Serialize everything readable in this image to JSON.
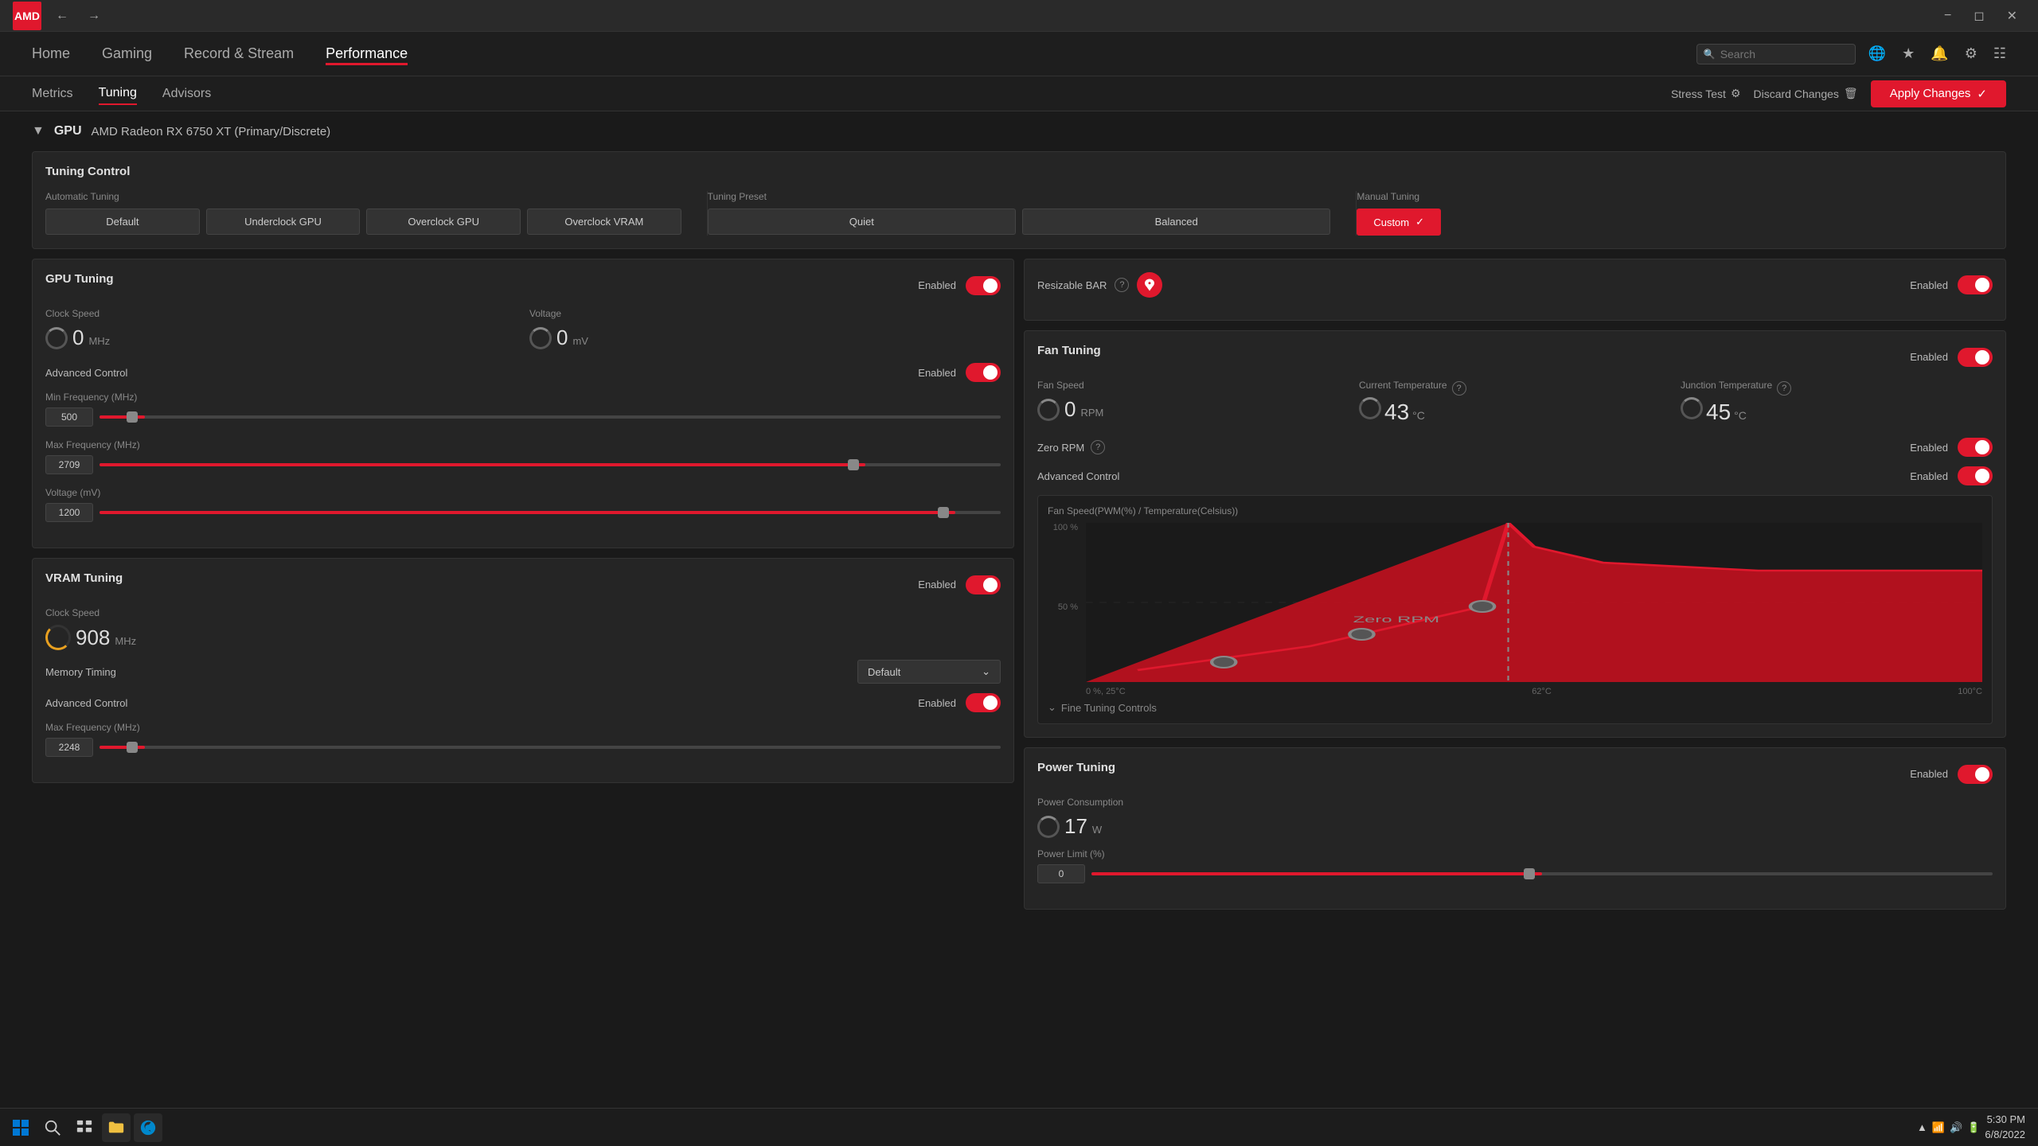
{
  "app": {
    "logo": "AMD",
    "nav": {
      "back_icon": "←",
      "forward_icon": "→",
      "items": [
        "Home",
        "Gaming",
        "Record & Stream",
        "Performance"
      ],
      "active": "Performance"
    },
    "search": {
      "placeholder": "Search"
    },
    "nav_icons": [
      "globe-icon",
      "star-icon",
      "bell-icon",
      "gear-icon",
      "grid-icon"
    ],
    "window_controls": [
      "minimize-icon",
      "restore-icon",
      "close-icon"
    ]
  },
  "sub_nav": {
    "items": [
      "Metrics",
      "Tuning",
      "Advisors"
    ],
    "active": "Tuning",
    "stress_test": "Stress Test",
    "discard": "Discard Changes",
    "apply": "Apply Changes"
  },
  "gpu_section": {
    "label": "GPU",
    "name": "AMD Radeon RX 6750 XT (Primary/Discrete)"
  },
  "tuning_control": {
    "title": "Tuning Control",
    "automatic_tuning": {
      "label": "Automatic Tuning",
      "presets": [
        "Default",
        "Underclock GPU",
        "Overclock GPU",
        "Overclock VRAM"
      ]
    },
    "tuning_preset": {
      "label": "Tuning Preset",
      "presets": [
        "Quiet",
        "Balanced"
      ]
    },
    "manual_tuning": {
      "label": "Manual Tuning",
      "value": "Custom"
    }
  },
  "gpu_tuning": {
    "title": "GPU Tuning",
    "enabled_label": "Enabled",
    "enabled": true,
    "clock_speed": {
      "label": "Clock Speed",
      "value": "0",
      "unit": "MHz"
    },
    "voltage": {
      "label": "Voltage",
      "value": "0",
      "unit": "mV"
    },
    "advanced_control": {
      "label": "Advanced Control",
      "value": "Enabled",
      "enabled": true
    },
    "min_frequency": {
      "label": "Min Frequency (MHz)",
      "value": "500",
      "slider_pct": 5
    },
    "max_frequency": {
      "label": "Max Frequency (MHz)",
      "value": "2709",
      "slider_pct": 85
    },
    "voltage_mv": {
      "label": "Voltage (mV)",
      "value": "1200",
      "slider_pct": 95
    }
  },
  "vram_tuning": {
    "title": "VRAM Tuning",
    "enabled_label": "Enabled",
    "enabled": true,
    "clock_speed": {
      "label": "Clock Speed",
      "value": "908",
      "unit": "MHz"
    },
    "memory_timing": {
      "label": "Memory Timing",
      "value": "Default"
    },
    "advanced_control": {
      "label": "Advanced Control",
      "value": "Enabled",
      "enabled": true
    },
    "max_frequency": {
      "label": "Max Frequency (MHz)",
      "value": "2248",
      "slider_pct": 5
    }
  },
  "resizable_bar": {
    "label": "Resizable BAR",
    "enabled_label": "Enabled",
    "enabled": true
  },
  "fan_tuning": {
    "title": "Fan Tuning",
    "enabled_label": "Enabled",
    "enabled": true,
    "fan_speed": {
      "label": "Fan Speed",
      "value": "0",
      "unit": "RPM"
    },
    "current_temperature": {
      "label": "Current Temperature",
      "value": "43",
      "unit": "°C"
    },
    "junction_temperature": {
      "label": "Junction Temperature",
      "value": "45",
      "unit": "°C"
    },
    "zero_rpm": {
      "label": "Zero RPM",
      "enabled_label": "Enabled",
      "enabled": true
    },
    "advanced_control": {
      "label": "Advanced Control",
      "enabled_label": "Enabled",
      "enabled": true
    },
    "chart": {
      "title": "Fan Speed(PWM(%) / Temperature(Celsius))",
      "y_labels": [
        "100 %",
        "50 %",
        "0 %, 25°C"
      ],
      "x_label_left": "0 %, 25°C",
      "x_label_mid": "62°C",
      "x_label_right": "100°C",
      "zero_rpm_label": "Zero RPM"
    },
    "fine_tuning": "Fine Tuning Controls"
  },
  "power_tuning": {
    "title": "Power Tuning",
    "enabled_label": "Enabled",
    "enabled": true,
    "power_consumption": {
      "label": "Power Consumption",
      "value": "17",
      "unit": "W"
    },
    "power_limit": {
      "label": "Power Limit (%)",
      "value": "0",
      "slider_pct": 50
    }
  },
  "taskbar": {
    "time": "5:30 PM",
    "date": "6/8/2022"
  }
}
